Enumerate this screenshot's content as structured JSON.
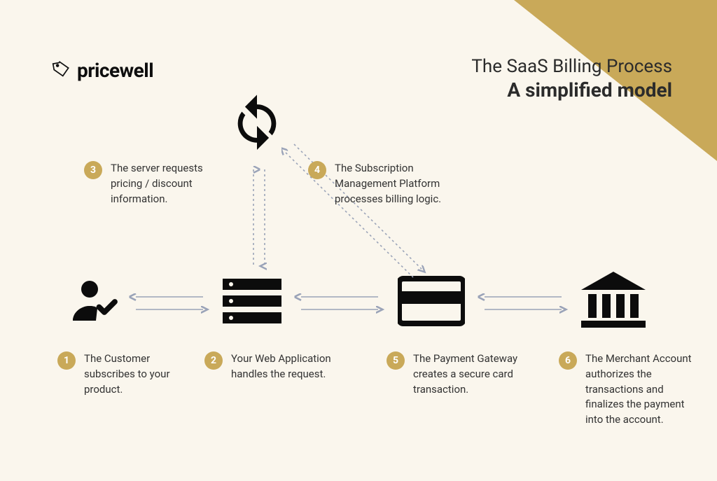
{
  "brand": "pricewell",
  "title_line1": "The SaaS Billing Process",
  "title_line2": "A simplified model",
  "steps": {
    "s1": {
      "n": "1",
      "t": "The Customer subscribes to your product."
    },
    "s2": {
      "n": "2",
      "t": "Your Web Application handles the request."
    },
    "s3": {
      "n": "3",
      "t": "The server requests pricing / discount information."
    },
    "s4": {
      "n": "4",
      "t": "The Subscription Management Platform processes billing logic."
    },
    "s5": {
      "n": "5",
      "t": "The Payment Gateway creates a secure card transaction."
    },
    "s6": {
      "n": "6",
      "t": "The Merchant Account authorizes the transactions and finalizes the payment into the account."
    }
  },
  "colors": {
    "accent": "#c9a959",
    "arrow": "#9aa3b8",
    "bg": "#faf6ed"
  }
}
